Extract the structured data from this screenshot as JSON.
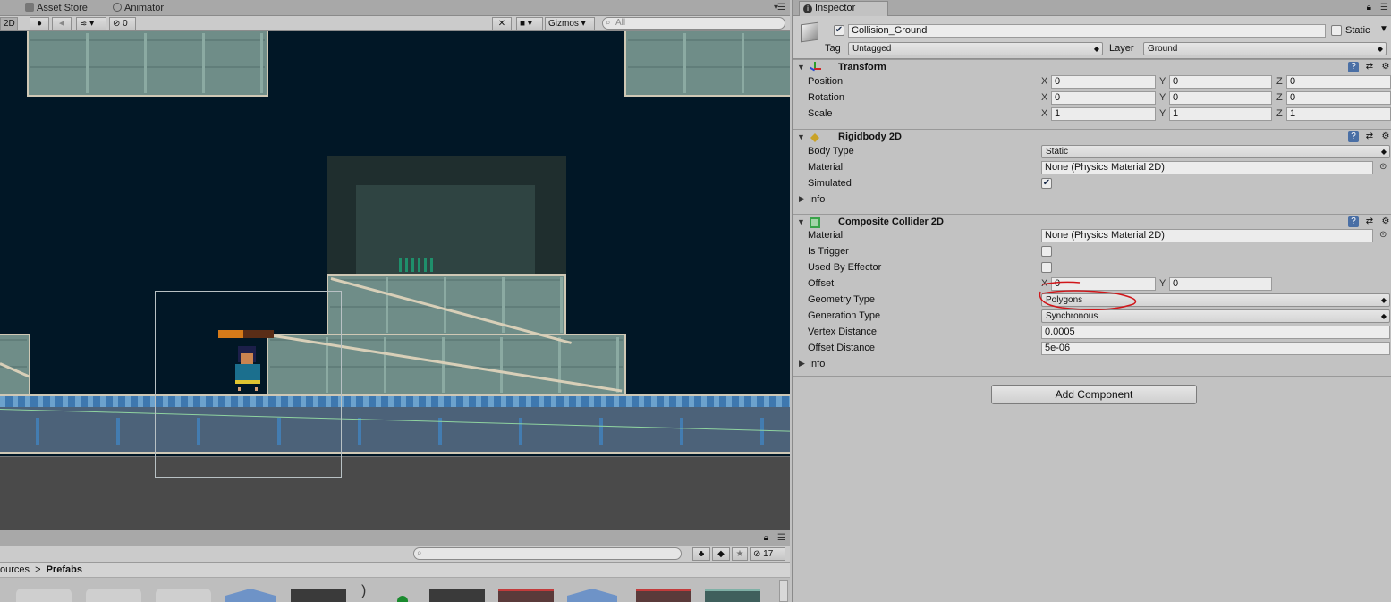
{
  "scene": {
    "tabs": [
      {
        "label": "Asset Store",
        "icon": "asset-store-icon"
      },
      {
        "label": "Animator",
        "icon": "animator-icon"
      }
    ],
    "toolbar": {
      "mode_2d": "2D",
      "hidden_count": "0",
      "gizmos": "Gizmos",
      "search_placeholder": "All"
    }
  },
  "project": {
    "search_placeholder": "",
    "hidden_count": "17",
    "breadcrumb": {
      "parent": "ources",
      "separator": ">",
      "current": "Prefabs"
    }
  },
  "inspector": {
    "tab_label": "Inspector",
    "object": {
      "active": true,
      "name": "Collision_Ground",
      "static_label": "Static",
      "static": false,
      "tag_label": "Tag",
      "tag": "Untagged",
      "layer_label": "Layer",
      "layer": "Ground"
    },
    "transform": {
      "title": "Transform",
      "rows": [
        {
          "label": "Position",
          "x": "0",
          "y": "0",
          "z": "0"
        },
        {
          "label": "Rotation",
          "x": "0",
          "y": "0",
          "z": "0"
        },
        {
          "label": "Scale",
          "x": "1",
          "y": "1",
          "z": "1"
        }
      ]
    },
    "rigidbody": {
      "title": "Rigidbody 2D",
      "body_type_label": "Body Type",
      "body_type": "Static",
      "material_label": "Material",
      "material": "None (Physics Material 2D)",
      "simulated_label": "Simulated",
      "simulated": true,
      "info_label": "Info"
    },
    "composite": {
      "title": "Composite Collider 2D",
      "material_label": "Material",
      "material": "None (Physics Material 2D)",
      "is_trigger_label": "Is Trigger",
      "is_trigger": false,
      "used_by_effector_label": "Used By Effector",
      "used_by_effector": false,
      "offset_label": "Offset",
      "offset_x": "0",
      "offset_y": "0",
      "geometry_type_label": "Geometry Type",
      "geometry_type": "Polygons",
      "generation_type_label": "Generation Type",
      "generation_type": "Synchronous",
      "vertex_distance_label": "Vertex Distance",
      "vertex_distance": "0.0005",
      "offset_distance_label": "Offset Distance",
      "offset_distance": "5e-06",
      "info_label": "Info"
    },
    "add_component": "Add Component"
  },
  "axes": {
    "x": "X",
    "y": "Y",
    "z": "Z"
  },
  "colors": {
    "annotation": "#d0161a",
    "checkbox": "#1a2b4a",
    "sky": "#011726"
  }
}
